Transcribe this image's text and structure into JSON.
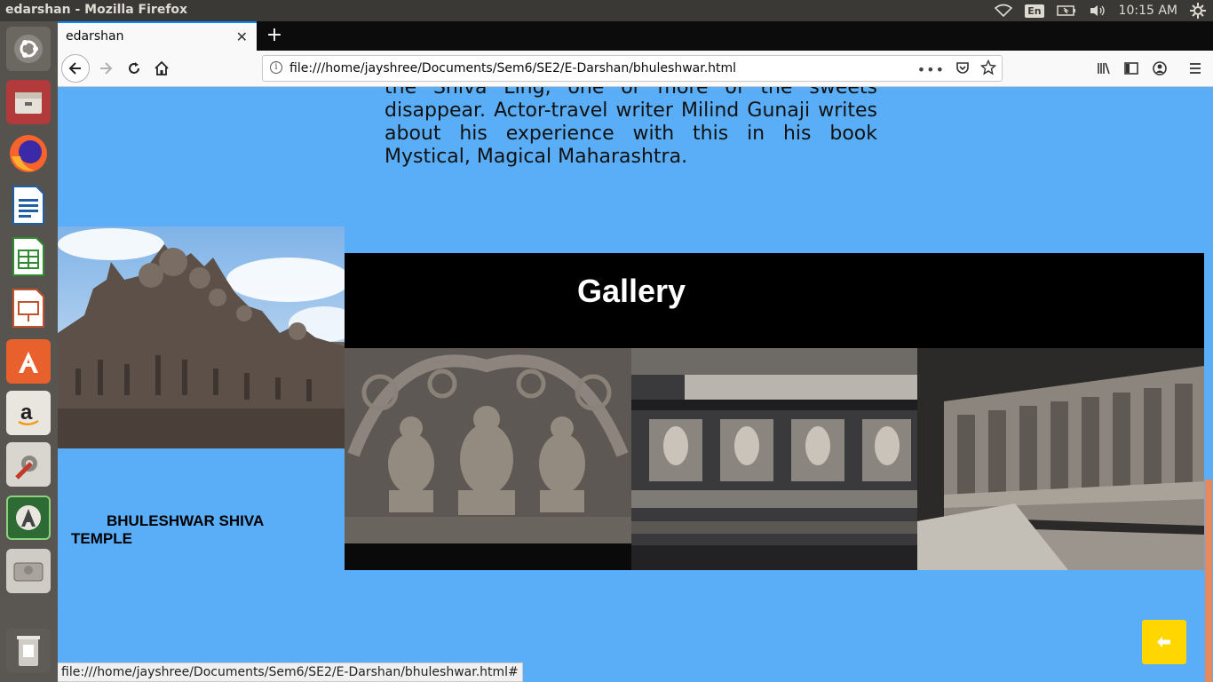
{
  "os": {
    "window_title": "edarshan - Mozilla Firefox",
    "keyboard_layout": "En",
    "clock": "10:15 AM",
    "launcher_icons": [
      "ubuntu-dash-icon",
      "files-icon",
      "firefox-icon",
      "writer-icon",
      "calc-icon",
      "impress-icon",
      "software-center-icon",
      "amazon-icon",
      "system-settings-icon",
      "software-updater-icon",
      "drive-icon",
      "trash-icon"
    ]
  },
  "browser": {
    "tab_title": "edarshan",
    "url": "file:///home/jayshree/Documents/Sem6/SE2/E-Darshan/bhuleshwar.html",
    "status_url": "file:///home/jayshree/Documents/Sem6/SE2/E-Darshan/bhuleshwar.html#"
  },
  "page": {
    "background_color": "#5aaef7",
    "description_tail": "the Shiva Ling, one or more of the sweets disappear. Actor-travel writer Milind Gunaji writes about his experience with this in his book Mystical, Magical Maharashtra.",
    "temple_caption": "BHULESHWAR SHIVA TEMPLE",
    "gallery_title": "Gallery",
    "gallery_images": [
      "carved-deities-relief",
      "carved-niches-wall",
      "carved-frieze-wall"
    ],
    "back_button_icon": "left-arrow-icon",
    "back_button_color": "#ffd600"
  }
}
